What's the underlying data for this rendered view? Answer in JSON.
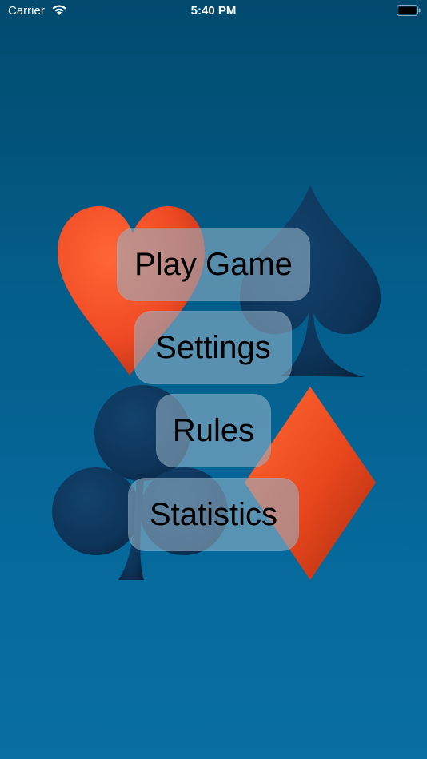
{
  "status_bar": {
    "carrier": "Carrier",
    "time": "5:40 PM",
    "icons": [
      "wifi-icon",
      "battery-icon"
    ]
  },
  "decorations": {
    "icons": [
      "heart-suit-icon",
      "spade-suit-icon",
      "club-suit-icon",
      "diamond-suit-icon"
    ],
    "colors": {
      "red_suit": "#ff5a2a",
      "dark_suit": "#0b2d4f"
    }
  },
  "menu": {
    "play_game": "Play Game",
    "settings": "Settings",
    "rules": "Rules",
    "statistics": "Statistics"
  },
  "colors": {
    "background_top": "#024a6e",
    "background_bottom": "#0a6fa3",
    "button_fill": "rgba(150,180,200,0.58)"
  }
}
